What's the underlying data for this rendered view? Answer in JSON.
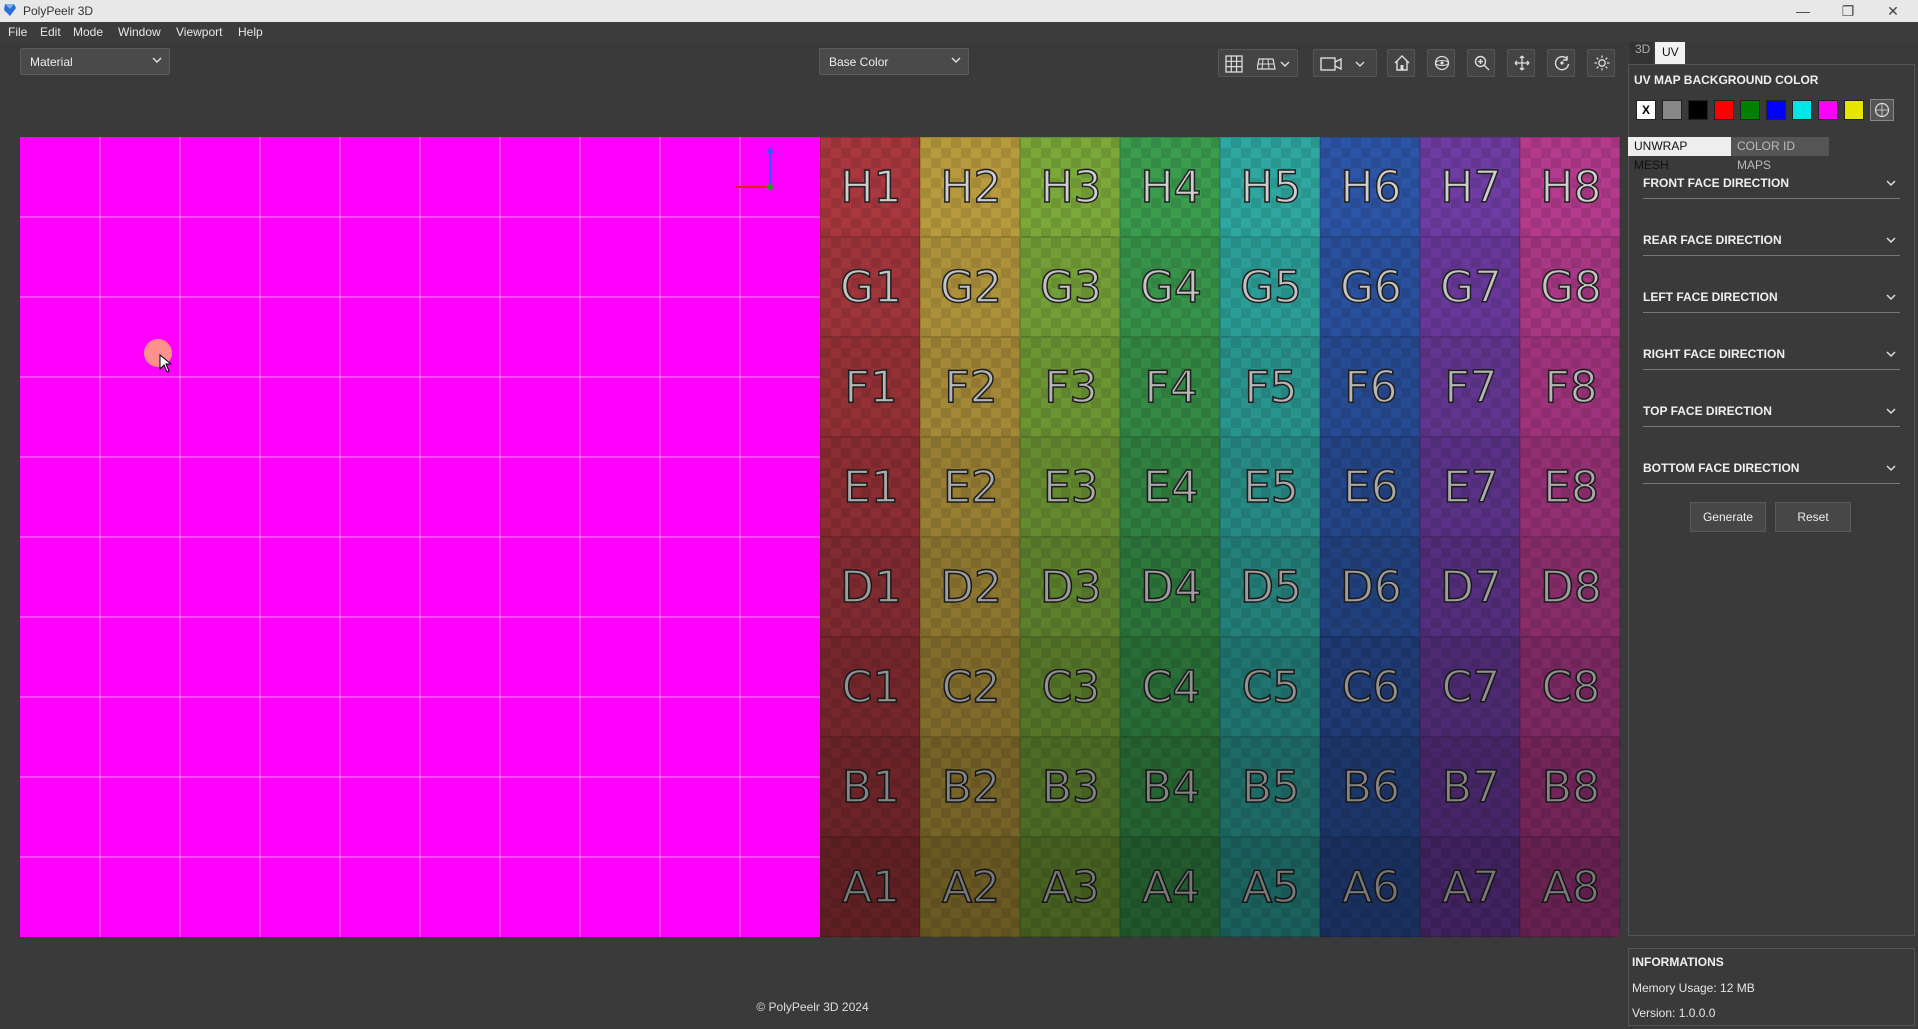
{
  "window": {
    "title": "PolyPeelr 3D",
    "controls": [
      "minimize-icon",
      "maximize-icon",
      "close-icon"
    ]
  },
  "menu": [
    "File",
    "Edit",
    "Mode",
    "Window",
    "Viewport",
    "Help"
  ],
  "toolbar": {
    "material_select": "Material",
    "channel_select": "Base Color",
    "icons": [
      "grid-icon",
      "grid-options-icon",
      "camera-icon",
      "home-icon",
      "view-orbit-icon",
      "zoom-icon",
      "pan-icon",
      "rotate-icon",
      "light-icon"
    ]
  },
  "uv_grid": {
    "rows": [
      "H",
      "G",
      "F",
      "E",
      "D",
      "C",
      "B",
      "A"
    ],
    "cols": [
      "1",
      "2",
      "3",
      "4",
      "5",
      "6",
      "7",
      "8"
    ],
    "column_colors": [
      "#a8383e",
      "#b89a3e",
      "#7aa83a",
      "#3b9c4e",
      "#2fa7a0",
      "#2c55a6",
      "#6e3ca3",
      "#b33a8c"
    ]
  },
  "footer": "© PolyPeelr 3D  2024",
  "panel": {
    "tabs": [
      "3D",
      "UV"
    ],
    "active_tab": "UV",
    "uv_bg_title": "UV MAP BACKGROUND COLOR",
    "swatches": [
      {
        "name": "white",
        "color": "#ffffff",
        "label": "X"
      },
      {
        "name": "gray",
        "color": "#888888",
        "label": ""
      },
      {
        "name": "black",
        "color": "#000000",
        "label": ""
      },
      {
        "name": "red",
        "color": "#ff0000",
        "label": ""
      },
      {
        "name": "green",
        "color": "#008000",
        "label": ""
      },
      {
        "name": "blue",
        "color": "#0000ff",
        "label": ""
      },
      {
        "name": "cyan",
        "color": "#00e5e5",
        "label": ""
      },
      {
        "name": "magenta",
        "color": "#ff00ff",
        "label": ""
      },
      {
        "name": "yellow",
        "color": "#e5e500",
        "label": ""
      }
    ],
    "subtabs": [
      "UNWRAP MESH",
      "COLOR ID MAPS"
    ],
    "sections": [
      "FRONT FACE DIRECTION",
      "REAR FACE DIRECTION",
      "LEFT FACE DIRECTION",
      "RIGHT FACE DIRECTION",
      "TOP FACE DIRECTION",
      "BOTTOM FACE DIRECTION"
    ],
    "generate_label": "Generate",
    "reset_label": "Reset"
  },
  "info": {
    "title": "INFORMATIONS",
    "memory": "Memory Usage: 12 MB",
    "version": "Version: 1.0.0.0"
  }
}
